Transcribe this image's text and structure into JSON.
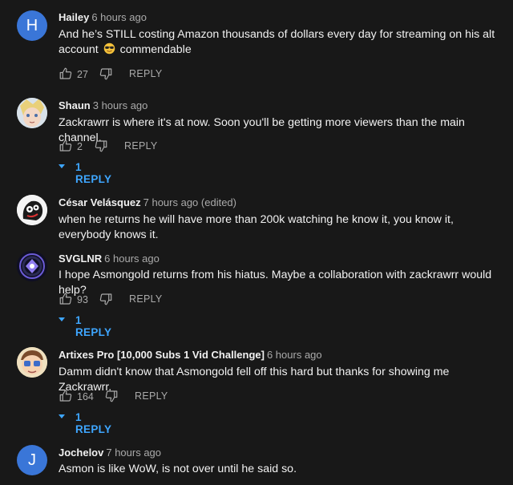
{
  "comments": [
    {
      "author": "Hailey",
      "time": "6 hours ago",
      "avatar_letter": "H",
      "text_before": "And he’s STILL costing Amazon thousands of dollars every day for streaming on his alt account",
      "text_after": "commendable",
      "emoji_icon": "sunglasses-emoji-icon",
      "likes": "27",
      "reply_label": "REPLY"
    },
    {
      "author": "Shaun",
      "time": "3 hours ago",
      "text": "Zackrawrr is where it's at now. Soon you'll be getting more viewers than the main channel.",
      "likes": "2",
      "reply_label": "REPLY",
      "replies_label": "1 REPLY"
    },
    {
      "author": "César Velásquez",
      "time": "7 hours ago (edited)",
      "text": "when he returns he will have more than 200k watching he know it, you know it, everybody knows it."
    },
    {
      "author": "SVGLNR",
      "time": "6 hours ago",
      "text": "I hope Asmongold returns from his hiatus. Maybe a collaboration with zackrawrr would help?",
      "likes": "93",
      "reply_label": "REPLY",
      "replies_label": "1 REPLY"
    },
    {
      "author": "Artixes Pro [10,000 Subs 1 Vid Challenge]",
      "time": "6 hours ago",
      "text": "Damm didn't know that Asmongold fell off this hard but thanks for showing me Zackrawrr.",
      "likes": "164",
      "reply_label": "REPLY",
      "replies_label": "1 REPLY"
    },
    {
      "author": "Jochelov",
      "time": "7 hours ago",
      "avatar_letter": "J",
      "text": "Asmon is like WoW, is not over until he said so."
    }
  ],
  "colors": {
    "background": "#181818",
    "text_primary": "#f1f1f1",
    "text_secondary": "#aaaaaa",
    "link_blue": "#3ea6ff",
    "avatar_blue": "#3a76d8"
  }
}
